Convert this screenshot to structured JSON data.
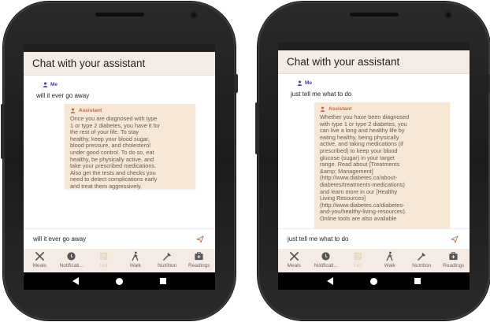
{
  "colors": {
    "app_bar": "#f4ece4",
    "bubble": "#f6e7d6",
    "me_accent": "#3c3fb3",
    "assistant_accent": "#c0694a"
  },
  "phones": [
    {
      "app_title": "Chat with your assistant",
      "me_label": "Me",
      "user_message": "will it ever go away",
      "assistant_label": "Assistant",
      "assistant_message": "Once you are diagnosed with type\n1 or type 2 diabetes, you have it for\nthe rest of your life. To stay\nhealthy, keep your blood sugar,\nblood pressure, and cholesterol\nunder good control. To do so, eat\nhealthy, be physically active, and\ntake your prescribed medications.\nAlso get the tests and checks you\nneed to detect complications early\nand treat them aggressively.",
      "input_value": "will it ever go away",
      "tabs": [
        "Meals",
        "Notificati...",
        "List",
        "Walk",
        "Nutrition",
        "Readings"
      ]
    },
    {
      "app_title": "Chat with your assistant",
      "me_label": "Me",
      "user_message": "just tell me what to do",
      "assistant_label": "Assistant",
      "assistant_message": "Whether you have been diagnosed\nwith type 1 or type 2 diabetes, you\ncan live a long and healthy life by\neating healthy, being physically\nactive, and taking medications (if\nprescribed) to keep your blood\nglucose (sugar) in your target\nrange. Read about [Treatments\n&amp; Management]\n(http://www.diabetes.ca/about-\ndiabetes/treatments-medications)\nand learn more in our [Healthy\nLiving Resources]\n(http://www.diabetes.ca/diabetes-\nand-you/healthy-living-resources).\nOnline tools are also available",
      "input_value": "just tell me what to do",
      "tabs": [
        "Meals",
        "Notificati...",
        "List",
        "Walk",
        "Nutrition",
        "Readings"
      ]
    }
  ],
  "icons": {
    "send": "send-icon",
    "person": "person-icon",
    "tabs": [
      "utensils-icon",
      "bell-icon",
      "list-icon",
      "walk-icon",
      "nutrition-icon",
      "medkit-icon"
    ]
  }
}
